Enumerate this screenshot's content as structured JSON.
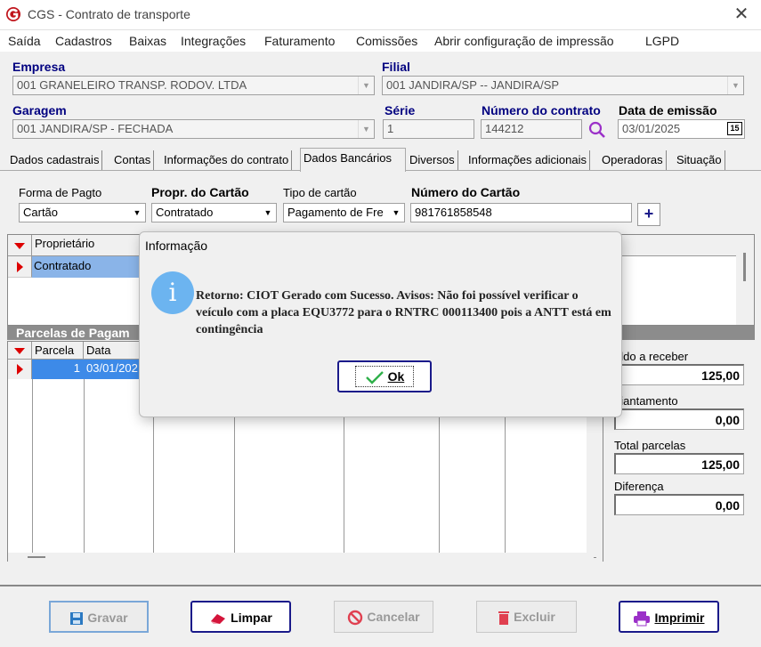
{
  "window": {
    "title": "CGS - Contrato de transporte",
    "close": "✕"
  },
  "menu": [
    "Saída",
    "Cadastros",
    "Baixas",
    "Integrações",
    "Faturamento",
    "Comissões",
    "Abrir configuração de impressão",
    "LGPD"
  ],
  "header": {
    "empresa_label": "Empresa",
    "empresa_value": "001 GRANELEIRO TRANSP. RODOV. LTDA",
    "filial_label": "Filial",
    "filial_value": "001 JANDIRA/SP -- JANDIRA/SP",
    "garagem_label": "Garagem",
    "garagem_value": "001 JANDIRA/SP - FECHADA",
    "serie_label": "Série",
    "serie_value": "1",
    "numero_label": "Número do contrato",
    "numero_value": "144212",
    "emissao_label": "Data de emissão",
    "emissao_value": "03/01/2025",
    "calendar_glyph": "15"
  },
  "tabs": [
    "Dados cadastrais",
    "Contas",
    "Informações do contrato",
    "Dados Bancários",
    "Diversos",
    "Informações adicionais",
    "Operadoras",
    "Situação"
  ],
  "active_tab": "Dados Bancários",
  "payment": {
    "forma_label": "Forma de Pagto",
    "forma_value": "Cartão",
    "propr_label": "Propr. do Cartão",
    "propr_value": "Contratado",
    "tipo_label": "Tipo de cartão",
    "tipo_value": "Pagamento de Fre",
    "numero_label": "Número do Cartão",
    "numero_value": "981761858548",
    "add_glyph": "+"
  },
  "owner_grid": {
    "header": "Proprietário",
    "row": "Contratado"
  },
  "parcelas": {
    "title": "Parcelas de Pagam",
    "col_parcela": "Parcela",
    "col_data": "Data",
    "row_parcela": "1",
    "row_data": "03/01/202"
  },
  "totals": {
    "saldo_label": "aldo a receber",
    "saldo_value": "125,00",
    "adiant_label": "diantamento",
    "adiant_value": "0,00",
    "total_label": "Total parcelas",
    "total_value": "125,00",
    "dif_label": "Diferença",
    "dif_value": "0,00"
  },
  "footer": {
    "gravar": "Gravar",
    "limpar": "Limpar",
    "cancelar": "Cancelar",
    "excluir": "Excluir",
    "imprimir": "Imprimir"
  },
  "dialog": {
    "title": "Informação",
    "icon": "i",
    "message": "Retorno: CIOT Gerado com Sucesso. Avisos: Não foi possível verificar o veículo com a placa EQU3772 para o RNTRC 000113400 pois a ANTT está em contingência",
    "ok_label": "Ok"
  },
  "colors": {
    "accent": "#000080",
    "selection": "#8ab4e8",
    "info_icon": "#6cb4f0",
    "button_border": "#1a1a8a"
  }
}
